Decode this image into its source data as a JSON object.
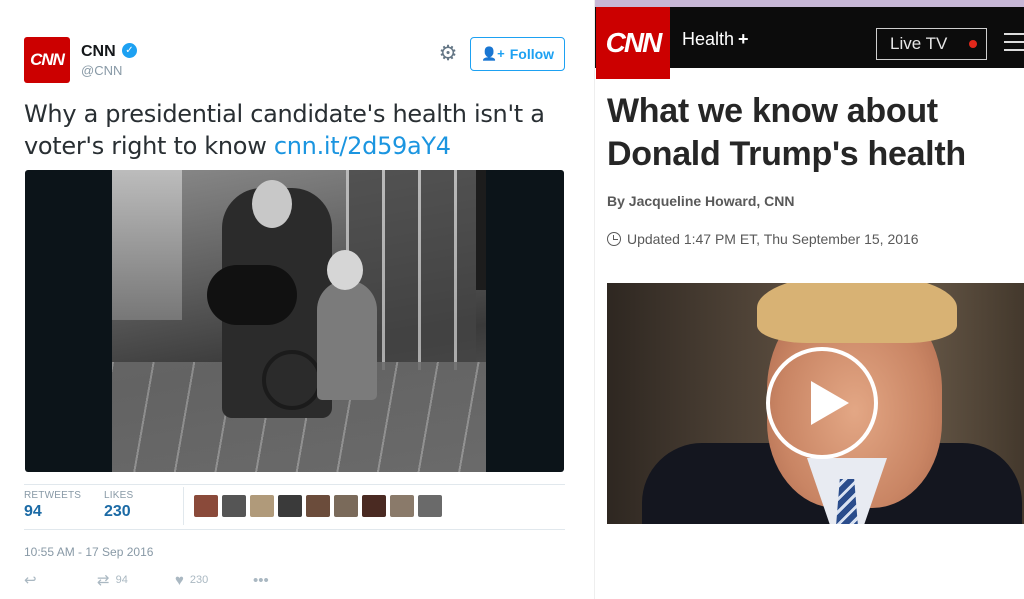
{
  "tweet": {
    "account_name": "CNN",
    "handle": "@CNN",
    "logo_text": "CNN",
    "follow_label": "Follow",
    "text": "Why a presidential candidate's health isn't a voter's right to know ",
    "link": "cnn.it/2d59aY4",
    "stats": {
      "retweets_label": "RETWEETS",
      "retweets_value": "94",
      "likes_label": "LIKES",
      "likes_value": "230"
    },
    "timestamp": "10:55 AM - 17 Sep 2016",
    "actions": {
      "retweet_count": "94",
      "like_count": "230"
    },
    "avatars": [
      {
        "color": "#8a4a3a"
      },
      {
        "color": "#555555"
      },
      {
        "color": "#b09a7a"
      },
      {
        "color": "#3a3a3a"
      },
      {
        "color": "#6b4c3b"
      },
      {
        "color": "#7a6a5a"
      },
      {
        "color": "#4a2a22"
      },
      {
        "color": "#8a7a6a"
      },
      {
        "color": "#6a6a6a"
      }
    ],
    "accent_color": "#1da1f2",
    "icons": {
      "verified": "verified-badge-icon",
      "gear": "gear-icon",
      "follow": "add-person-icon",
      "reply": "reply-icon",
      "retweet": "retweet-icon",
      "like": "heart-icon",
      "more": "more-icon"
    }
  },
  "article": {
    "logo_text": "CNN",
    "section": "Health",
    "section_suffix": "+",
    "live_tv_label": "Live TV",
    "headline": "What we know about Donald Trump's health",
    "byline": "By Jacqueline Howard, CNN",
    "updated": "Updated 1:47 PM ET, Thu September 15, 2016",
    "brand_color": "#cc0000",
    "icons": {
      "clock": "clock-icon",
      "play": "play-icon",
      "menu": "hamburger-menu-icon",
      "live_dot": "live-dot-icon"
    }
  }
}
